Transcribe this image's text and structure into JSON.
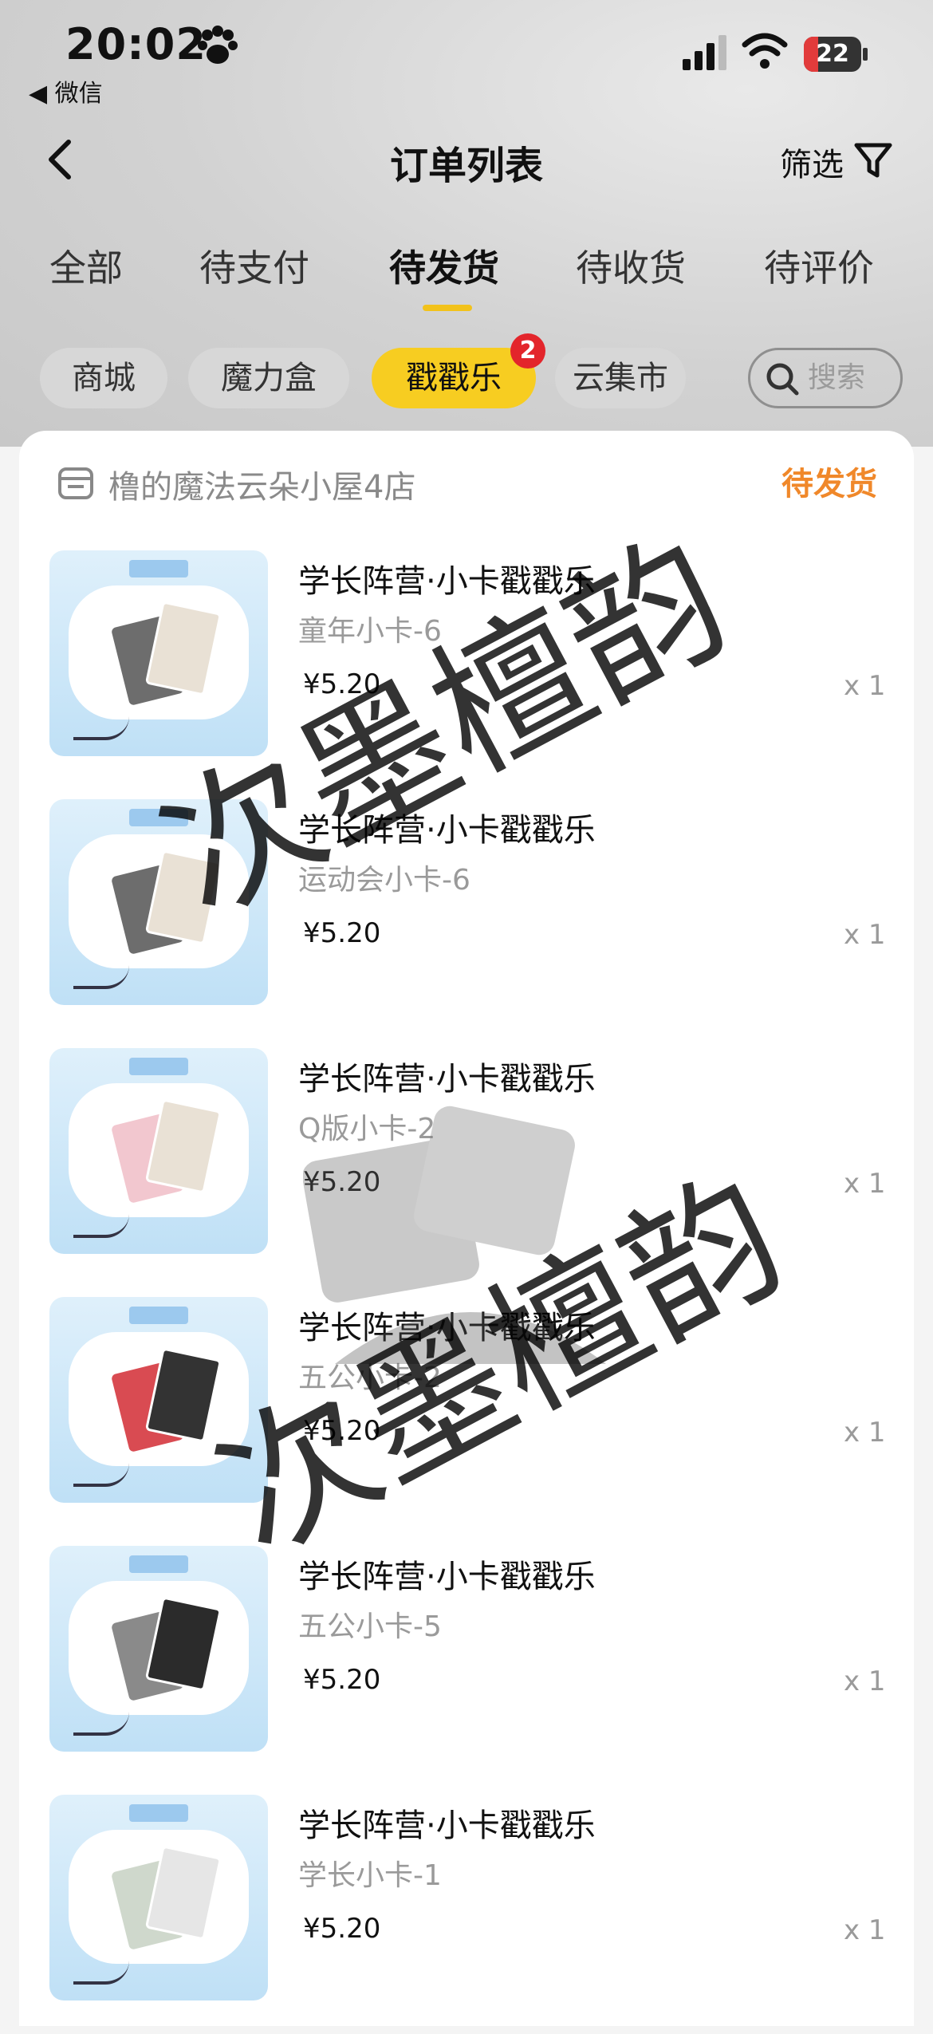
{
  "status_bar": {
    "time": "20:02",
    "back_app": "◀ 微信",
    "battery": "22"
  },
  "navbar": {
    "title": "订单列表",
    "filter_label": "筛选"
  },
  "tabs": [
    "全部",
    "待支付",
    "待发货",
    "待收货",
    "待评价"
  ],
  "chips": {
    "items": [
      "商城",
      "魔力盒",
      "戳戳乐",
      "云集市"
    ],
    "badge": "2",
    "search_placeholder": "搜索"
  },
  "order": {
    "shop_name": "橹的魔法云朵小屋4店",
    "status": "待发货",
    "items": [
      {
        "title": "学长阵营·小卡戳戳乐",
        "spec": "童年小卡-6",
        "price": "¥5.20",
        "qty": "x 1"
      },
      {
        "title": "学长阵营·小卡戳戳乐",
        "spec": "运动会小卡-6",
        "price": "¥5.20",
        "qty": "x 1"
      },
      {
        "title": "学长阵营·小卡戳戳乐",
        "spec": "Q版小卡-2",
        "price": "¥5.20",
        "qty": "x 1"
      },
      {
        "title": "学长阵营·小卡戳戳乐",
        "spec": "五公小卡-2",
        "price": "¥5.20",
        "qty": "x 1"
      },
      {
        "title": "学长阵营·小卡戳戳乐",
        "spec": "五公小卡-5",
        "price": "¥5.20",
        "qty": "x 1"
      },
      {
        "title": "学长阵营·小卡戳戳乐",
        "spec": "学长小卡-1",
        "price": "¥5.20",
        "qty": "x 1"
      }
    ]
  },
  "watermark": "次墨檀韵",
  "colors": {
    "accent": "#f7cd21",
    "status_orange": "#f0882a",
    "badge_red": "#e3252b"
  }
}
